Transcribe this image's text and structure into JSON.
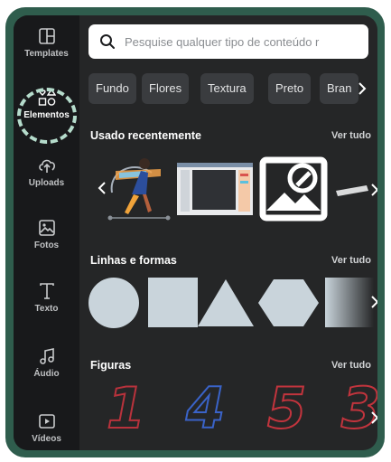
{
  "sidebar": {
    "items": [
      {
        "label": "Templates",
        "icon": "templates-icon"
      },
      {
        "label": "Elementos",
        "icon": "elements-icon",
        "active": true
      },
      {
        "label": "Uploads",
        "icon": "upload-cloud-icon"
      },
      {
        "label": "Fotos",
        "icon": "photo-icon"
      },
      {
        "label": "Texto",
        "icon": "text-icon"
      },
      {
        "label": "Áudio",
        "icon": "music-note-icon"
      },
      {
        "label": "Vídeos",
        "icon": "video-icon"
      }
    ]
  },
  "search": {
    "placeholder": "Pesquise qualquer tipo de conteúdo r"
  },
  "chips": [
    "Fundo",
    "Flores",
    "Textura",
    "Preto",
    "Bran"
  ],
  "sections": {
    "recent": {
      "title": "Usado recentemente",
      "see_all": "Ver tudo"
    },
    "lines": {
      "title": "Linhas e formas",
      "see_all": "Ver tudo"
    },
    "figures": {
      "title": "Figuras",
      "see_all": "Ver tudo",
      "numbers": [
        "1",
        "4",
        "5",
        "3"
      ]
    }
  },
  "colors": {
    "background": "#252627",
    "sidebar": "#18191b",
    "frame": "#2f5d4d",
    "highlight": "#b5dccc",
    "shape_fill": "#c9d4db"
  }
}
